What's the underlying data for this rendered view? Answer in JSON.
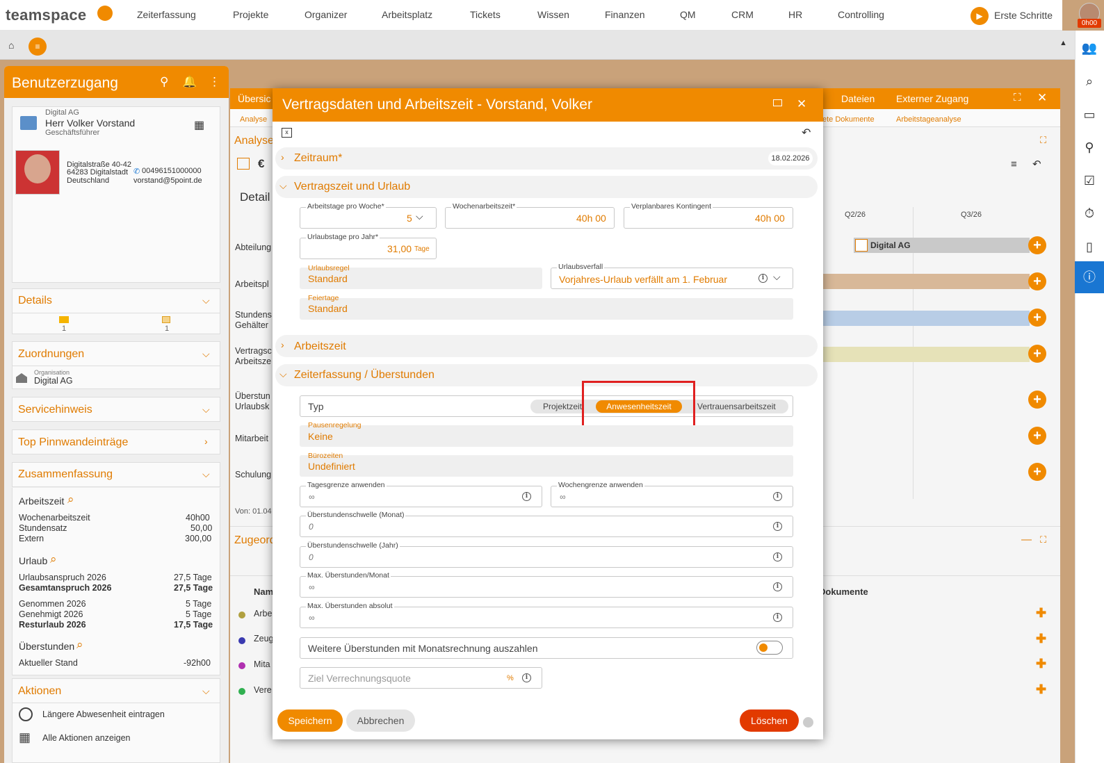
{
  "topnav": {
    "logo": "teamspace",
    "items": [
      "Zeiterfassung",
      "Projekte",
      "Organizer",
      "Arbeitsplatz",
      "Tickets",
      "Wissen",
      "Finanzen",
      "QM",
      "CRM",
      "HR",
      "Controlling"
    ],
    "erste_schritte": "Erste Schritte",
    "time_badge": "0h00"
  },
  "left_panel": {
    "title": "Benutzerzugang",
    "user": {
      "company": "Digital AG",
      "name": "Herr Volker Vorstand",
      "role": "Geschäftsführer",
      "street": "Digitalstraße 40-42",
      "city": "64283 Digitalstadt",
      "country": "Deutschland",
      "phone": "00496151000000",
      "email": "vorstand@5point.de"
    },
    "details": {
      "title": "Details",
      "count1": "1",
      "count2": "1"
    },
    "zuordnungen": {
      "title": "Zuordnungen",
      "org_label": "Organisation",
      "org_value": "Digital AG"
    },
    "servicehinweis": "Servicehinweis",
    "pinnwand": "Top Pinnwandeinträge",
    "zusammenfassung": {
      "title": "Zusammenfassung",
      "arbeitszeit": "Arbeitszeit",
      "wochenarbeitszeit": "Wochenarbeitszeit",
      "wochenarbeitszeit_v": "40h00",
      "stundensatz": "Stundensatz",
      "stundensatz_v": "50,00",
      "extern": "Extern",
      "extern_v": "300,00",
      "urlaub": "Urlaub",
      "anspruch": "Urlaubsanspruch 2026",
      "anspruch_v": "27,5 Tage",
      "gesamt": "Gesamtanspruch 2026",
      "gesamt_v": "27,5 Tage",
      "genommen": "Genommen 2026",
      "genommen_v": "5 Tage",
      "genehmigt": "Genehmigt 2026",
      "genehmigt_v": "5 Tage",
      "rest": "Resturlaub 2026",
      "rest_v": "17,5 Tage",
      "ueberstunden": "Überstunden",
      "aktuell": "Aktueller Stand",
      "aktuell_v": "-92h00"
    },
    "aktionen": {
      "title": "Aktionen",
      "a1": "Längere Abwesenheit eintragen",
      "a2": "Alle Aktionen anzeigen"
    }
  },
  "background": {
    "tab_left": "Übersic",
    "tab_dateien": "Dateien",
    "tab_extern": "Externer Zugang",
    "sub_analyse": "Analyse",
    "sub_dok": "ete Dokumente",
    "sub_arbeitstage": "Arbeitstageanalyse",
    "analyse_title": "Analyse",
    "detail": "Detail",
    "q2": "Q2/26",
    "q3": "Q3/26",
    "bar_label": "Digital AG",
    "rows": [
      "Abteilung",
      "Arbeitspl",
      "Stundens",
      "Gehälter",
      "Vertragsc",
      "Arbeitsze",
      "Überstun",
      "Urlaubsk",
      "Mitarbeit",
      "Schulung"
    ],
    "von": "Von: 01.04",
    "zugeord": "Zugeord",
    "nam": "Nam",
    "dokumente": "Dokumente",
    "list": [
      "Arbe",
      "Zeug",
      "Mita",
      "Vere"
    ]
  },
  "modal": {
    "title": "Vertragsdaten und Arbeitszeit - Vorstand, Volker",
    "zeitraum": "Zeitraum*",
    "zeitraum_date": "18.02.2026",
    "vertragszeit": "Vertragszeit und Urlaub",
    "arbeitstage_label": "Arbeitstage pro Woche*",
    "arbeitstage_value": "5",
    "wochenarbeitszeit_label": "Wochenarbeitszeit*",
    "wochenarbeitszeit_value": "40h 00",
    "kontingent_label": "Verplanbares Kontingent",
    "kontingent_value": "40h 00",
    "urlaubstage_label": "Urlaubstage pro Jahr*",
    "urlaubstage_value": "31,00",
    "urlaubstage_unit": "Tage",
    "urlaubsregel_label": "Urlaubsregel",
    "urlaubsregel_value": "Standard",
    "urlaubsverfall_label": "Urlaubsverfall",
    "urlaubsverfall_value": "Vorjahres-Urlaub verfällt am 1. Februar",
    "feiertage_label": "Feiertage",
    "feiertage_value": "Standard",
    "arbeitszeit": "Arbeitszeit",
    "zeiterfassung": "Zeiterfassung / Überstunden",
    "typ_label": "Typ",
    "typ_options": [
      "Projektzeit",
      "Anwesenheitszeit",
      "Vertrauensarbeitszeit"
    ],
    "pausen_label": "Pausenregelung",
    "pausen_value": "Keine",
    "buero_label": "Bürozeiten",
    "buero_value": "Undefiniert",
    "tagesgrenze_label": "Tagesgrenze anwenden",
    "tagesgrenze_value": "∞",
    "wochengrenze_label": "Wochengrenze anwenden",
    "wochengrenze_value": "∞",
    "schwelle_monat_label": "Überstundenschwelle (Monat)",
    "schwelle_monat_value": "0",
    "schwelle_jahr_label": "Überstundenschwelle (Jahr)",
    "schwelle_jahr_value": "0",
    "max_monat_label": "Max. Überstunden/Monat",
    "max_monat_value": "∞",
    "max_abs_label": "Max. Überstunden absolut",
    "max_abs_value": "∞",
    "auszahlen_label": "Weitere Überstunden mit Monatsrechnung auszahlen",
    "ziel_placeholder": "Ziel Verrechnungsquote",
    "ziel_unit": "%",
    "speichern": "Speichern",
    "abbrechen": "Abbrechen",
    "loeschen": "Löschen"
  },
  "colors": {
    "accent": "#f08a00",
    "danger": "#e23a00",
    "active_blue": "#1976d2"
  }
}
